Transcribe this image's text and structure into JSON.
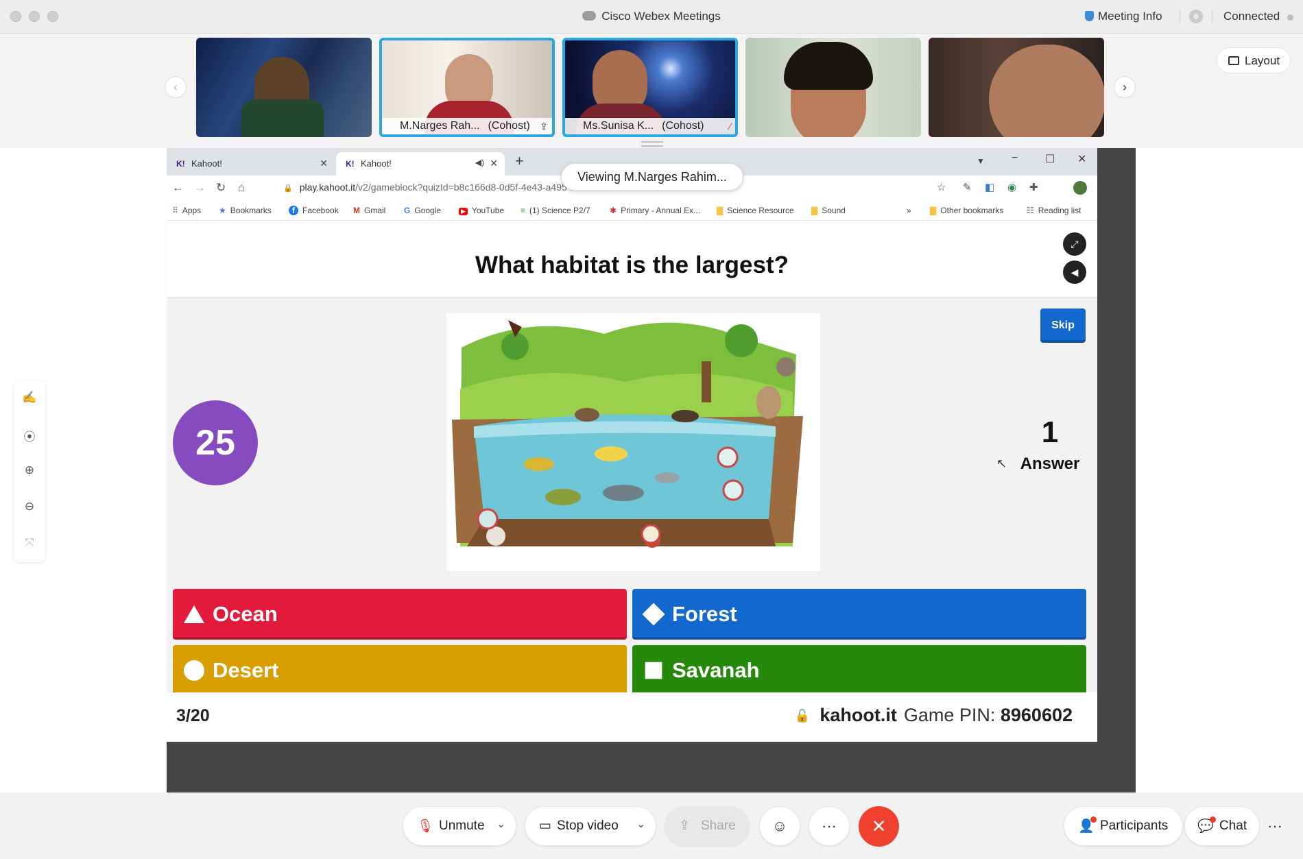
{
  "app": {
    "title": "Cisco Webex Meetings",
    "meeting_info": "Meeting Info",
    "status": "Connected",
    "layout_label": "Layout"
  },
  "participants": [
    {
      "name": "",
      "cohost_label": ""
    },
    {
      "name": "M.Narges Rah...",
      "cohost_label": "(Cohost)"
    },
    {
      "name": "Ms.Sunisa K...",
      "cohost_label": "(Cohost)"
    },
    {
      "name": "",
      "cohost_label": ""
    },
    {
      "name": "",
      "cohost_label": ""
    }
  ],
  "share": {
    "viewing_label": "Viewing M.Narges Rahim..."
  },
  "browser": {
    "tabs": [
      {
        "title": "Kahoot!",
        "favicon": "K!"
      },
      {
        "title": "Kahoot!",
        "favicon": "K!"
      }
    ],
    "url_main": "play.kahoot.it",
    "url_rest": "/v2/gameblock?quizId=b8c166d8-0d5f-4e43-a495-...",
    "bookmarks": [
      {
        "label": "Apps",
        "icon": "⠿"
      },
      {
        "label": "Bookmarks",
        "icon": "★"
      },
      {
        "label": "Facebook",
        "icon": "f"
      },
      {
        "label": "Gmail",
        "icon": "M"
      },
      {
        "label": "Google",
        "icon": "G"
      },
      {
        "label": "YouTube",
        "icon": "▶"
      },
      {
        "label": "(1) Science P2/7",
        "icon": "≡"
      },
      {
        "label": "Primary - Annual Ex...",
        "icon": "✱"
      },
      {
        "label": "Science Resource",
        "icon": "▇"
      },
      {
        "label": "Sound",
        "icon": "▇"
      }
    ],
    "bookmarks_more": "»",
    "other_bookmarks": "Other bookmarks",
    "reading_list": "Reading list"
  },
  "kahoot": {
    "question": "What habitat is the largest?",
    "timer": "25",
    "skip_label": "Skip",
    "answer_count": "1",
    "answer_label": "Answer",
    "answers": [
      {
        "label": "Ocean",
        "color": "#e21b3c",
        "shape": "triangle"
      },
      {
        "label": "Forest",
        "color": "#1368ce",
        "shape": "diamond"
      },
      {
        "label": "Desert",
        "color": "#d89e00",
        "shape": "circle"
      },
      {
        "label": "Savanah",
        "color": "#26890c",
        "shape": "square"
      }
    ],
    "progress": "3/20",
    "site": "kahoot.it",
    "pin_label": "Game PIN:",
    "pin": "8960602"
  },
  "controls": {
    "unmute": "Unmute",
    "stop_video": "Stop video",
    "share": "Share",
    "participants": "Participants",
    "chat": "Chat"
  }
}
